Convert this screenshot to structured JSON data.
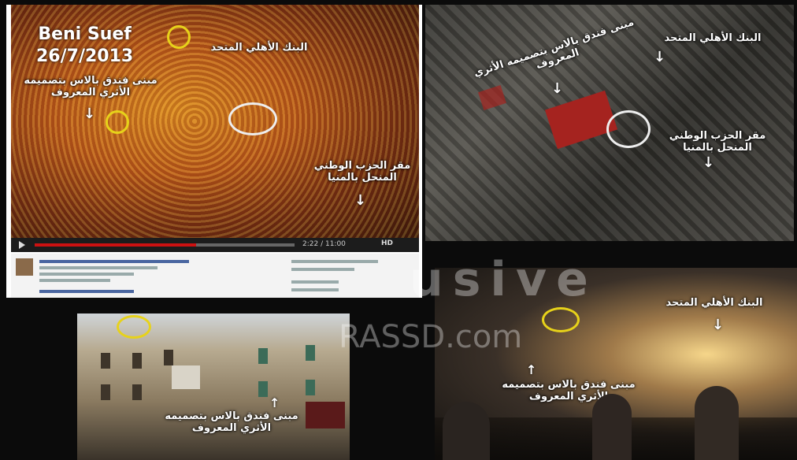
{
  "panel1": {
    "title_place": "Beni Suef",
    "title_date": "26/7/2013",
    "label_bank": "البنك الأهلي المتحد",
    "label_hotel": "مبنى فندق بالاس بتصميمه الأثري المعروف",
    "label_party": "مقر الحزب الوطني المنحل بالمنيا",
    "video_time": "2:22 / 11:00",
    "video_progress_fraction": 0.62,
    "hd_label": "HD"
  },
  "panel2": {
    "label_bank": "البنك الأهلي المتحد",
    "label_hotel": "مبنى فندق بالاس بتصميمه الأثري المعروف",
    "label_party": "مقر الحزب الوطني المنحل بالمنيا"
  },
  "panel3": {
    "label_hotel": "مبنى فندق بالاس بتصميمه الأثري المعروف"
  },
  "panel4": {
    "label_bank": "البنك الأهلي المتحد",
    "label_hotel": "مبنى فندق بالاس بتصميمه الأثري المعروف"
  },
  "watermark": {
    "word": "usive",
    "site": "RASSD.com"
  },
  "colors": {
    "highlight_circle": "#e7d21a",
    "accent_red": "#a5231f"
  }
}
